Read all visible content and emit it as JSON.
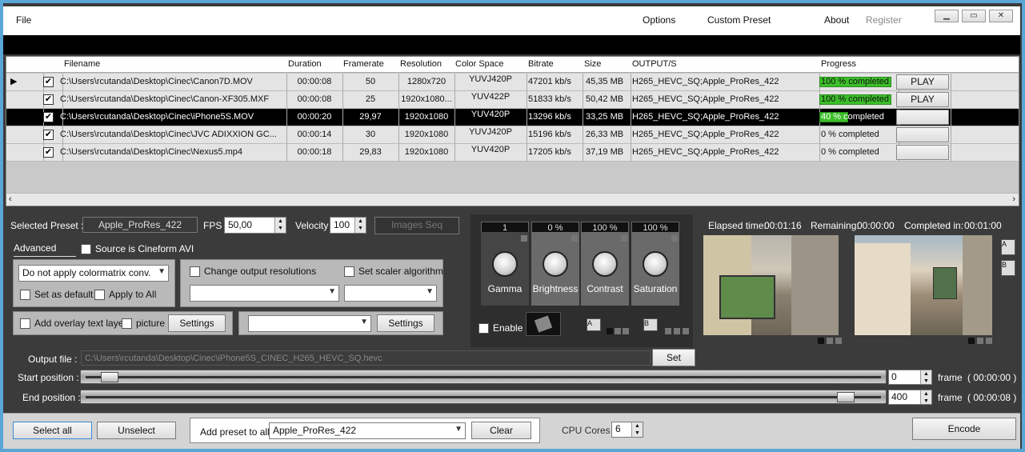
{
  "menu": {
    "file": "File",
    "options": "Options",
    "custom_preset": "Custom Preset",
    "about": "About",
    "register": "Register"
  },
  "window_buttons": {
    "minimize": "▁",
    "restore": "▭",
    "close": "✕"
  },
  "grid": {
    "columns": [
      "Filename",
      "Duration",
      "Framerate",
      "Resolution",
      "Color Space",
      "Bitrate",
      "Size",
      "OUTPUT/S",
      "Progress"
    ],
    "rows": [
      {
        "checked": "✔",
        "filename": "C:\\Users\\rcutanda\\Desktop\\Cinec\\Canon7D.MOV",
        "duration": "00:00:08",
        "framerate": "50",
        "resolution": "1280x720",
        "colorspace": "YUVJ420P",
        "bitrate": "47201 kb/s",
        "size": "45,35 MB",
        "output": "H265_HEVC_SQ;Apple_ProRes_422",
        "progress_text": "100 % completed",
        "progress": 1.0,
        "play": "PLAY"
      },
      {
        "checked": "✔",
        "filename": "C:\\Users\\rcutanda\\Desktop\\Cinec\\Canon-XF305.MXF",
        "duration": "00:00:08",
        "framerate": "25",
        "resolution": "1920x1080...",
        "colorspace": "YUV422P",
        "bitrate": "51833 kb/s",
        "size": "50,42 MB",
        "output": "H265_HEVC_SQ;Apple_ProRes_422",
        "progress_text": "100 % completed",
        "progress": 1.0,
        "play": "PLAY"
      },
      {
        "checked": "✔",
        "filename": "C:\\Users\\rcutanda\\Desktop\\Cinec\\iPhone5S.MOV",
        "duration": "00:00:20",
        "framerate": "29,97",
        "resolution": "1920x1080",
        "colorspace": "YUV420P",
        "bitrate": "13296 kb/s",
        "size": "33,25 MB",
        "output": "H265_HEVC_SQ;Apple_ProRes_422",
        "progress_text": "40 % completed",
        "progress": 0.4,
        "play": ""
      },
      {
        "checked": "✔",
        "filename": "C:\\Users\\rcutanda\\Desktop\\Cinec\\JVC ADIXXION GC...",
        "duration": "00:00:14",
        "framerate": "30",
        "resolution": "1920x1080",
        "colorspace": "YUVJ420P",
        "bitrate": "15196 kb/s",
        "size": "26,33 MB",
        "output": "H265_HEVC_SQ;Apple_ProRes_422",
        "progress_text": "0 % completed",
        "progress": 0,
        "play": ""
      },
      {
        "checked": "✔",
        "filename": "C:\\Users\\rcutanda\\Desktop\\Cinec\\Nexus5.mp4",
        "duration": "00:00:18",
        "framerate": "29,83",
        "resolution": "1920x1080",
        "colorspace": "YUV420P",
        "bitrate": "17205 kb/s",
        "size": "37,19 MB",
        "output": "H265_HEVC_SQ;Apple_ProRes_422",
        "progress_text": "0 % completed",
        "progress": 0,
        "play": ""
      }
    ]
  },
  "settings": {
    "selected_preset_label": "Selected Preset :",
    "selected_preset": "Apple_ProRes_422",
    "fps_label": "FPS",
    "fps": "50,00",
    "velocity_label": "Velocity",
    "velocity": "100",
    "images_seq": "Images Seq",
    "advanced_tab": "Advanced",
    "source_cineform": "Source is Cineform AVI",
    "colormatrix": "Do not apply colormatrix conv.",
    "set_default": "Set as default",
    "apply_all": "Apply to All",
    "change_res": "Change output resolutions",
    "set_scaler": "Set scaler algorithm",
    "add_overlay": "Add overlay text layer",
    "picture": "picture",
    "settings_btn": "Settings",
    "enable": "Enable"
  },
  "knobs": [
    {
      "name": "Gamma",
      "value": "1"
    },
    {
      "name": "Brightness",
      "value": "0 %"
    },
    {
      "name": "Contrast",
      "value": "100 %"
    },
    {
      "name": "Saturation",
      "value": "100 %"
    }
  ],
  "preview": {
    "elapsed_label": "Elapsed time:",
    "elapsed": "00:01:16",
    "remaining_label": "Remaining:",
    "remaining": "00:00:00",
    "completed_label": "Completed in:",
    "completed": "00:01:00",
    "a": "A",
    "b": "B"
  },
  "output": {
    "label": "Output file :",
    "path": "C:\\Users\\rcutanda\\Desktop\\Cinec\\iPhone5S_CINEC_H265_HEVC_SQ.hevc",
    "set": "Set"
  },
  "positions": {
    "start_label": "Start position :",
    "start_value": "0",
    "start_time": "( 00:00:00 )",
    "end_label": "End position :",
    "end_value": "400",
    "end_time": "( 00:00:08 )",
    "frame": "frame",
    "start_frac": 0.02,
    "end_frac": 0.97
  },
  "bottom": {
    "select_all": "Select all",
    "unselect": "Unselect",
    "add_preset": "Add preset to all",
    "preset": "Apple_ProRes_422",
    "clear": "Clear",
    "cpu_label": "CPU Cores",
    "cpu": "6",
    "encode": "Encode"
  }
}
